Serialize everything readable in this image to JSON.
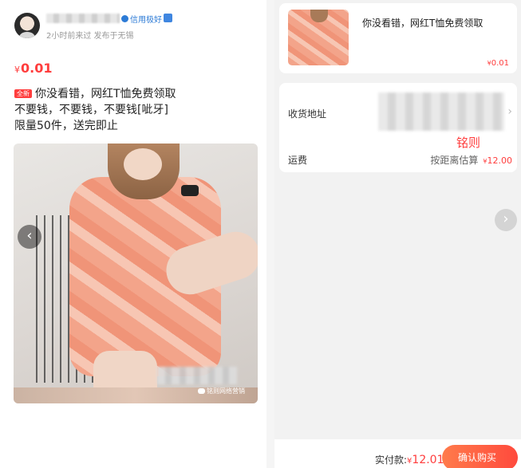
{
  "seller": {
    "credit_label": "信用极好",
    "meta": "2小时前来过 发布于无锡"
  },
  "listing": {
    "price_symbol": "¥",
    "price": "0.01",
    "new_tag": "全新",
    "title_line1": "你没看错，网红T恤免费领取",
    "title_line2": "不要钱，不要钱，不要钱[呲牙]",
    "title_line3": "限量50件，送完即止"
  },
  "watermark": {
    "text": "铭则网络营销"
  },
  "order": {
    "item_title": "你没看错，网红T恤免费领取",
    "item_price_symbol": "¥",
    "item_price": "0.01",
    "address_label": "收货地址",
    "overlay_text": "铭则",
    "shipping_label": "运费",
    "shipping_note": "按距离估算",
    "shipping_symbol": "¥",
    "shipping_price": "12.00",
    "pay_label": "实付款:",
    "pay_symbol": "¥",
    "pay_amount": "12.01",
    "buy_label": "确认购买"
  },
  "colors": {
    "price_red": "#ff3d3d",
    "credit_blue": "#2d7bd6",
    "button_gradient_start": "#ff7b4b",
    "button_gradient_end": "#ff4a3d"
  },
  "icons": {
    "prev": "chevron-left-icon",
    "next": "chevron-right-icon",
    "address": "chevron-right-icon",
    "wechat": "wechat-icon"
  }
}
